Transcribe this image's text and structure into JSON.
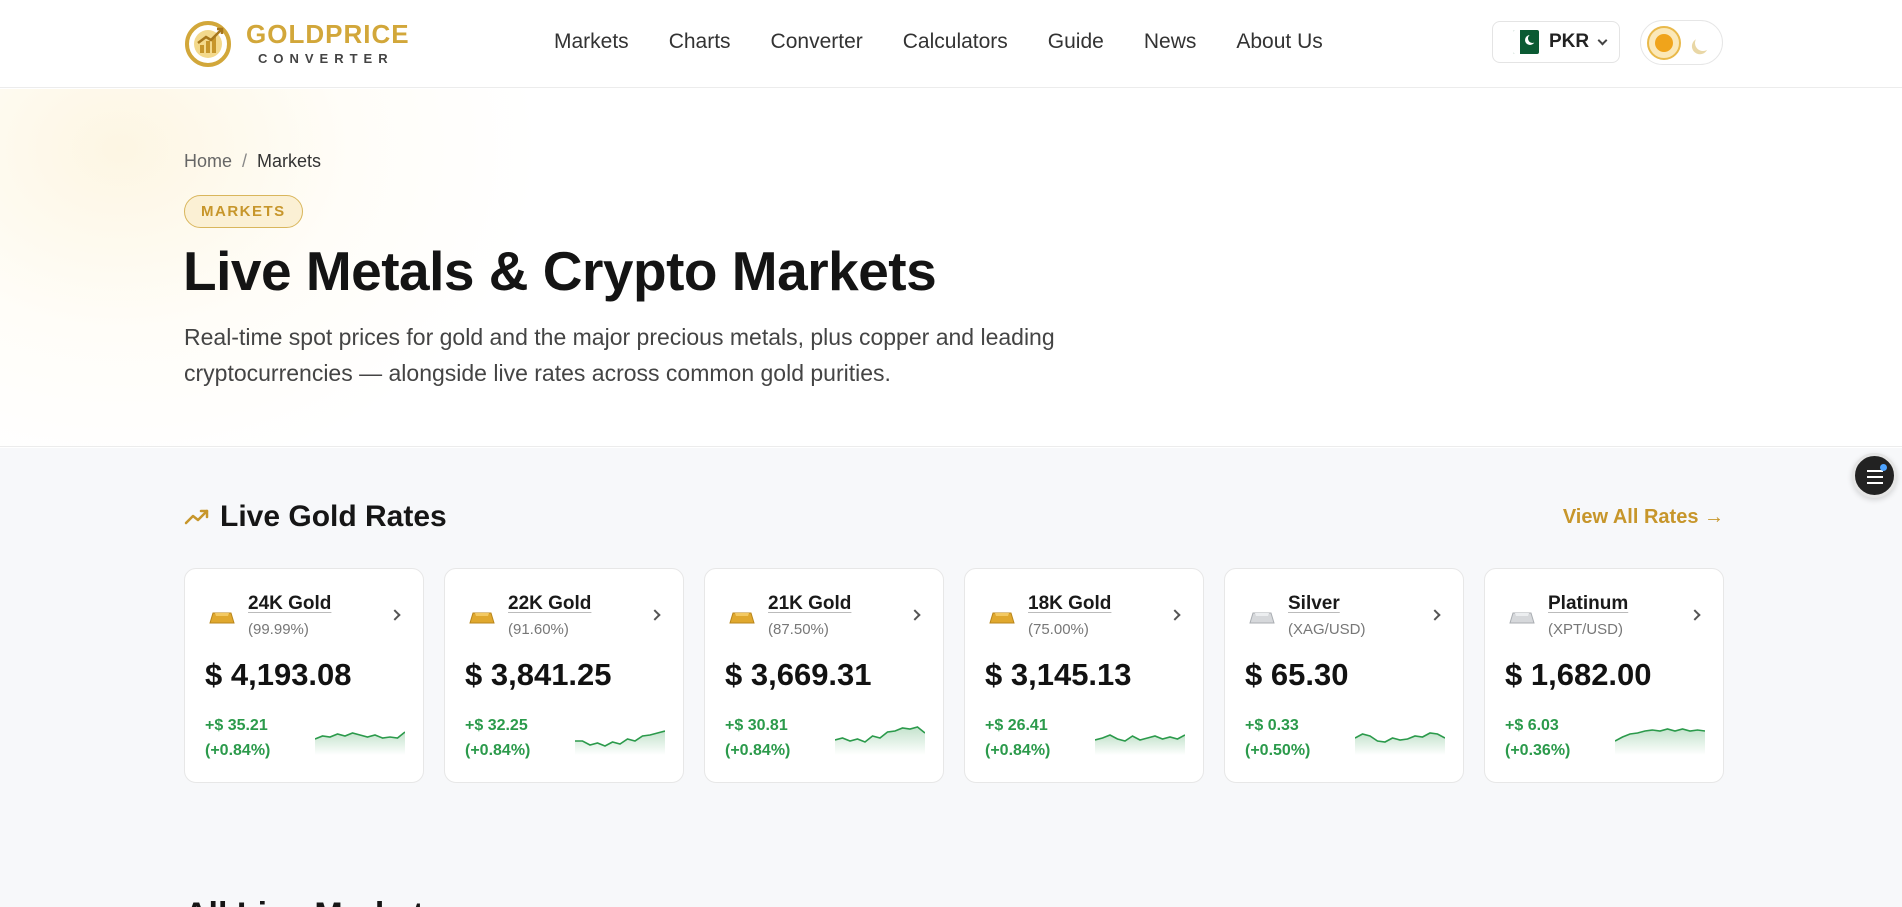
{
  "brand": {
    "name": "GOLDPRICE",
    "sub": "CONVERTER",
    "accent": "#d2a73a"
  },
  "nav": [
    "Markets",
    "Charts",
    "Converter",
    "Calculators",
    "Guide",
    "News",
    "About Us"
  ],
  "currency": {
    "code": "PKR",
    "flag": "pakistan-flag-icon"
  },
  "theme_toggle": {
    "light_icon": "sun-icon",
    "dark_icon": "moon-icon"
  },
  "breadcrumb": {
    "home": "Home",
    "separator": "/",
    "current": "Markets"
  },
  "hero": {
    "badge": "MARKETS",
    "title": "Live Metals & Crypto Markets",
    "description": "Real-time spot prices for gold and the major precious metals, plus copper and leading cryptocurrencies — alongside live rates across common gold purities."
  },
  "live_rates": {
    "title": "Live Gold Rates",
    "view_all": "View All Rates →",
    "positive_color": "#2b9a4b",
    "cards": [
      {
        "name": "24K Gold",
        "sub": "(99.99%)",
        "price": "$ 4,193.08",
        "change": "+$ 35.21",
        "change_pct": "(+0.84%)",
        "metal": "gold",
        "spark": [
          20,
          17,
          18,
          15,
          17,
          14,
          16,
          18,
          16,
          19,
          18,
          19,
          13
        ]
      },
      {
        "name": "22K Gold",
        "sub": "(91.60%)",
        "price": "$ 3,841.25",
        "change": "+$ 32.25",
        "change_pct": "(+0.84%)",
        "metal": "gold",
        "spark": [
          22,
          22,
          26,
          24,
          27,
          23,
          25,
          20,
          22,
          17,
          16,
          14,
          12
        ]
      },
      {
        "name": "21K Gold",
        "sub": "(87.50%)",
        "price": "$ 3,669.31",
        "change": "+$ 30.81",
        "change_pct": "(+0.84%)",
        "metal": "gold",
        "spark": [
          21,
          19,
          22,
          20,
          23,
          17,
          19,
          13,
          12,
          9,
          10,
          8,
          14
        ]
      },
      {
        "name": "18K Gold",
        "sub": "(75.00%)",
        "price": "$ 3,145.13",
        "change": "+$ 26.41",
        "change_pct": "(+0.84%)",
        "metal": "gold",
        "spark": [
          21,
          19,
          16,
          20,
          22,
          17,
          21,
          19,
          17,
          20,
          18,
          20,
          16
        ]
      },
      {
        "name": "Silver",
        "sub": "(XAG/USD)",
        "price": "$ 65.30",
        "change": "+$ 0.33",
        "change_pct": "(+0.50%)",
        "metal": "silver",
        "spark": [
          19,
          15,
          17,
          22,
          23,
          19,
          21,
          20,
          17,
          18,
          14,
          15,
          19
        ]
      },
      {
        "name": "Platinum",
        "sub": "(XPT/USD)",
        "price": "$ 1,682.00",
        "change": "+$ 6.03",
        "change_pct": "(+0.36%)",
        "metal": "silver",
        "spark": [
          22,
          18,
          15,
          14,
          12,
          11,
          12,
          10,
          12,
          10,
          12,
          11,
          12
        ]
      }
    ]
  },
  "all_markets": {
    "title": "All Live Markets"
  },
  "floating_menu": {
    "icon": "menu-icon"
  }
}
